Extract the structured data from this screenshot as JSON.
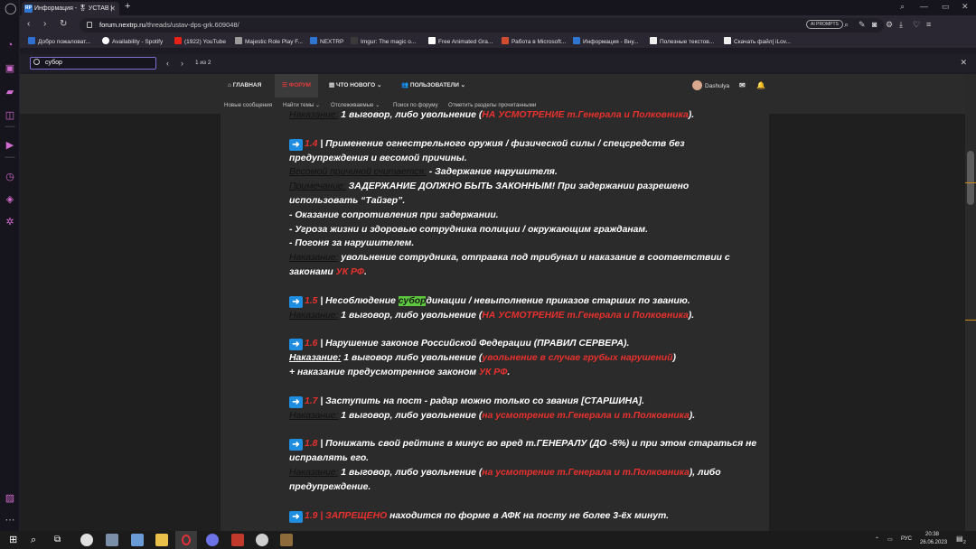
{
  "browser": {
    "tab_title": "Информация - 🎖 УСТАВ |",
    "url_domain": "forum.nextrp.ru",
    "url_path": "/threads/ustav-dps-grk.609048/",
    "aiprompts_label": "AI PROMPTS"
  },
  "bookmarks": [
    {
      "label": "Добро пожаловат...",
      "color": "#2f6fd0"
    },
    {
      "label": "Availability - Spotify",
      "color": "#ffffff"
    },
    {
      "label": "(1922) YouTube",
      "color": "#e62117"
    },
    {
      "label": "Majestic Role Play F...",
      "color": "#9b9b9b"
    },
    {
      "label": "NEXTRP",
      "color": "#2f76d2"
    },
    {
      "label": "Imgur: The magic o...",
      "color": "#3a3a3a"
    },
    {
      "label": "Free Animated Gra...",
      "color": "#ffffff"
    },
    {
      "label": "Работа в Microsoft...",
      "color": "#d14b2f"
    },
    {
      "label": "Информация - Вну...",
      "color": "#2f76d2"
    },
    {
      "label": "Полезные текстов...",
      "color": "#eeeeee"
    },
    {
      "label": "Скачать файл| iLov...",
      "color": "#eeeeee"
    }
  ],
  "find": {
    "query": "субор",
    "count": "1 из 2"
  },
  "forum_nav": {
    "home": "ГЛАВНАЯ",
    "forums": "ФОРУМ",
    "whats_new": "ЧТО НОВОГО",
    "users": "ПОЛЬЗОВАТЕЛИ",
    "username": "Dashulya"
  },
  "subnav": {
    "new_messages": "Новые сообщения",
    "find_threads": "Найти темы",
    "watched": "Отслеживаемые",
    "search_forum": "Поиск по форуму",
    "mark_read": "Отметить разделы прочитанными"
  },
  "post": {
    "top_cut_label": "Наказание:",
    "top_cut_text": " 1 выговор, либо увольнение (",
    "top_cut_red": "НА УСМОТРЕНИЕ т.Генерала и Полковника",
    "top_cut_end": ").",
    "r14_num": "1.4",
    "r14_text": " | Применение огнестрельного оружия / физической силы / спецсредств без предупреждения и весомой причины.",
    "r14_reason_label": "Весомой причиной считается:",
    "r14_reason_text": " - Задержание нарушителя.",
    "r14_note_label": "Примечание:",
    "r14_note_text": " ЗАДЕРЖАНИЕ ДОЛЖНО БЫТЬ ЗАКОННЫМ! При задержании разрешено использовать “Тайзер”.",
    "r14_l1": "- Оказание сопротивления при задержании.",
    "r14_l2": "- Угроза жизни и здоровью сотрудника полиции / окружающим гражданам.",
    "r14_l3": "- Погоня за нарушителем.",
    "r14_pun_label": "Наказание:",
    "r14_pun_text": " увольнение сотрудника, отправка под трибунал и наказание в соответствии с законами ",
    "r14_pun_red": "УК РФ",
    "r14_pun_end": ".",
    "r15_num": "1.5",
    "r15_pre": " | Несоблюдение ",
    "r15_hl": "субор",
    "r15_post": "динации / невыполнение приказов старших по званию.",
    "r15_pun_label": "Наказание:",
    "r15_pun_text": " 1 выговор, либо увольнение (",
    "r15_pun_red": "НА УСМОТРЕНИЕ т.Генерала и Полковника",
    "r15_pun_end": ").",
    "r16_num": "1.6",
    "r16_text": " | Нарушение законов Российской Федерации (ПРАВИЛ СЕРВЕРА).",
    "r16_pun_label": "Наказание:",
    "r16_pun_text": " 1 выговор либо увольнение (",
    "r16_pun_red": "увольнение в случае грубых нарушений",
    "r16_pun_end": ")",
    "r16_plus": "+ наказание предусмотренное законом ",
    "r16_plus_red": "УК РФ",
    "r16_plus_end": ".",
    "r17_num": "1.7",
    "r17_text": " | Заступить на пост - радар можно только со звания [СТАРШИНА].",
    "r17_pun_label": "Наказание:",
    "r17_pun_text": " 1 выговор, либо увольнение (",
    "r17_pun_red": "на усмотрение т.Генерала и т.Полковника",
    "r17_pun_end": ").",
    "r18_num": "1.8",
    "r18_text": " | Понижать свой рейтинг в минус во вред т.ГЕНЕРАЛУ (ДО -5%) и при этом стараться не исправлять его.",
    "r18_pun_label": "Наказание:",
    "r18_pun_text": " 1 выговор, либо увольнение (",
    "r18_pun_red": "на усмотрение т.Генерала и т.Полковника",
    "r18_pun_end": "), либо предупреждение.",
    "r19_num": "1.9",
    "r19_red": " | ЗАПРЕЩЕНО",
    "r19_text": " находится по форме в АФК на посту не более 3-ёх минут."
  },
  "taskbar": {
    "lang": "РУС",
    "time": "20:38",
    "date": "26.06.2023",
    "notifications": "2"
  }
}
